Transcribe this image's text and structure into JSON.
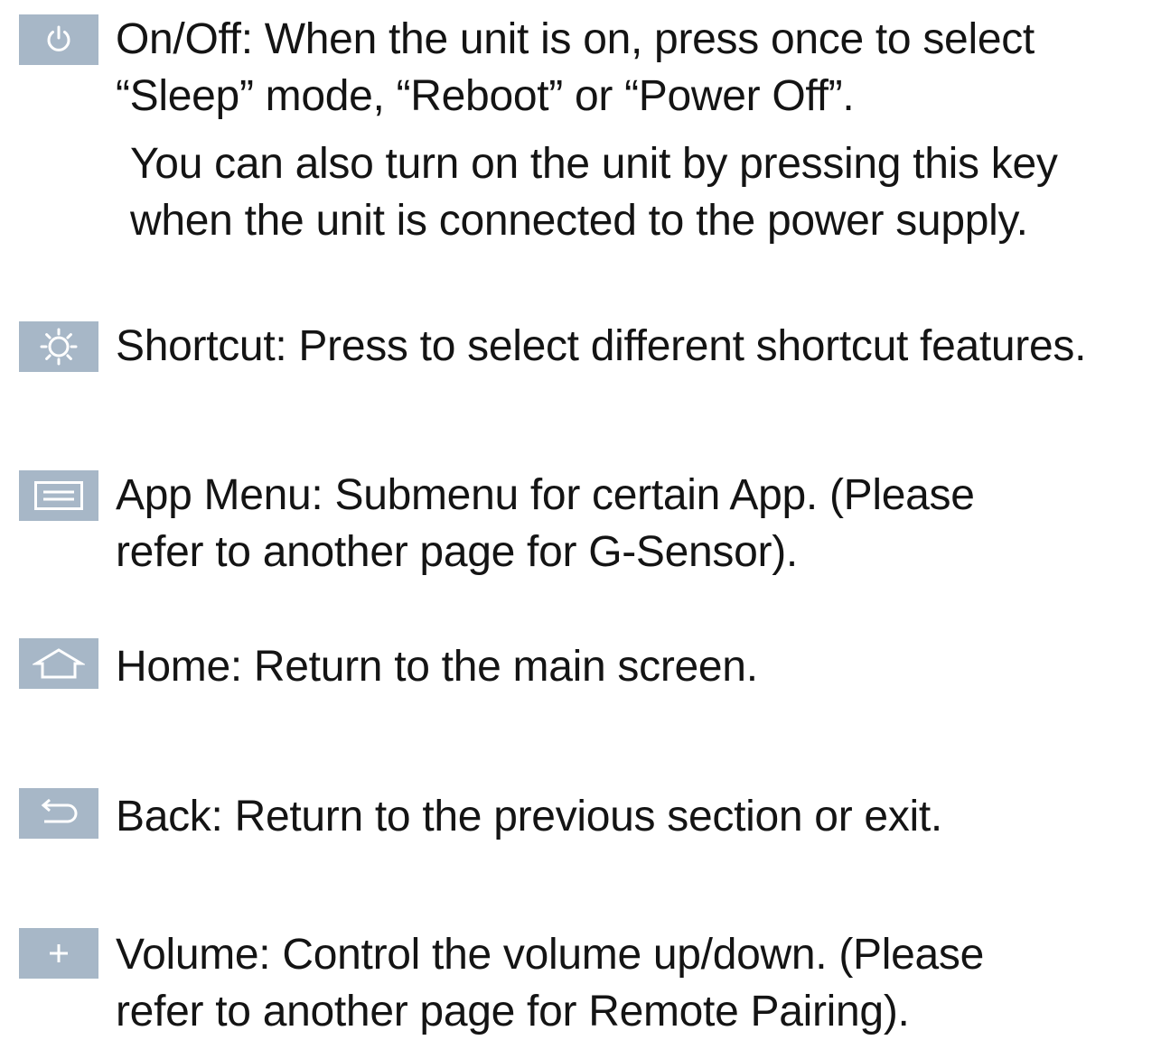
{
  "colors": {
    "icon_background": "#a7b7c7",
    "icon_glyph": "#ffffff",
    "text": "#141414"
  },
  "keys": [
    {
      "icon": "power-icon",
      "lines": [
        "On/Off: When the unit is on, press once to select",
        "“Sleep” mode, “Reboot” or “Power Off”.",
        "You can also turn on the unit by pressing this key",
        "when the unit is connected to the power supply."
      ]
    },
    {
      "icon": "sun-icon",
      "lines": [
        "Shortcut: Press to select different shortcut features."
      ]
    },
    {
      "icon": "menu-icon",
      "lines": [
        "App Menu: Submenu for certain App. (Please",
        "refer to another page for G-Sensor)."
      ]
    },
    {
      "icon": "home-icon",
      "lines": [
        "Home: Return to the main screen."
      ]
    },
    {
      "icon": "back-icon",
      "lines": [
        "Back: Return to the previous section or exit."
      ]
    },
    {
      "icon": "plus-icon",
      "lines": [
        "Volume: Control the volume up/down. (Please",
        "refer to another page for Remote Pairing)."
      ]
    }
  ]
}
